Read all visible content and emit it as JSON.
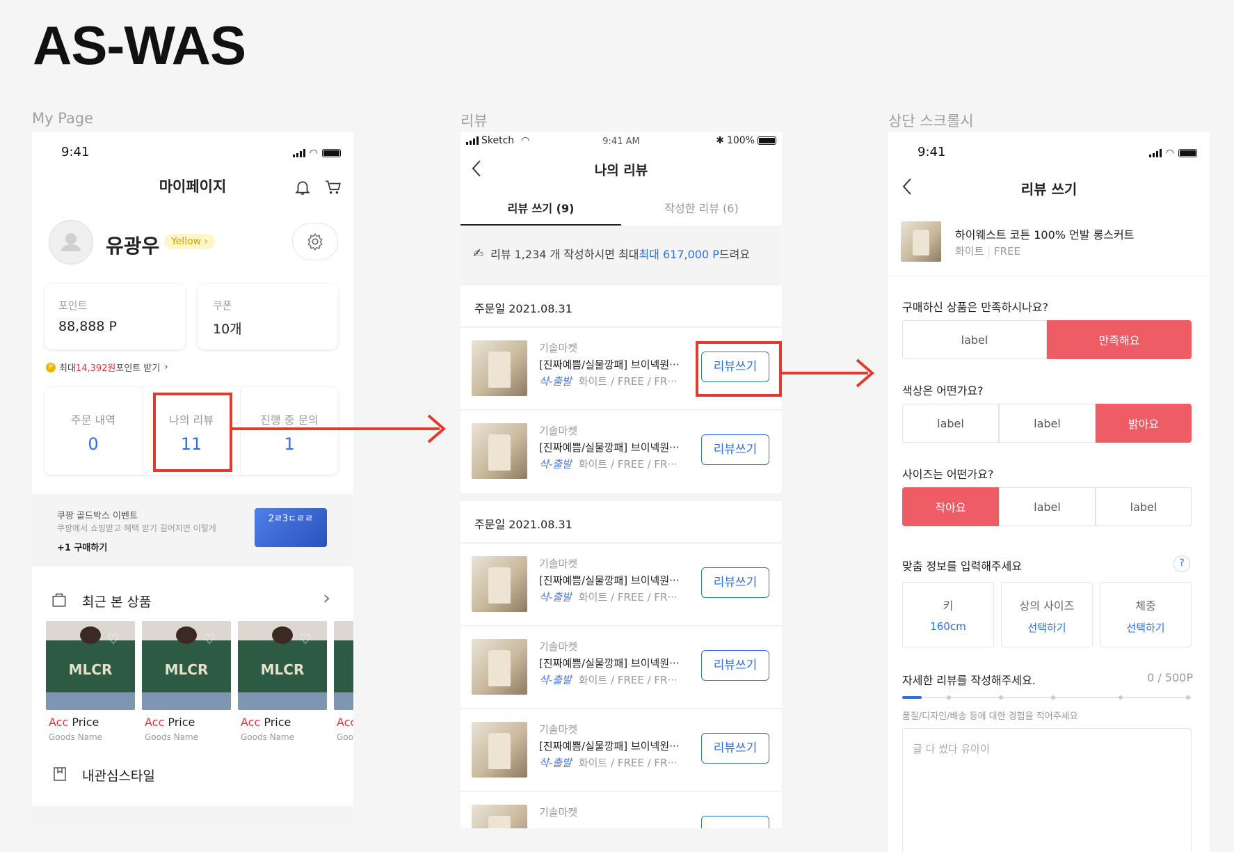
{
  "page_title": "AS-WAS",
  "captions": {
    "s1": "My Page",
    "s2": "리뷰",
    "s3": "상단 스크롤시"
  },
  "s1": {
    "time": "9:41",
    "header": "마이페이지",
    "user": "유광우",
    "grade": "Yellow ›",
    "point_label": "포인트",
    "point_value": "88,888 P",
    "coupon_label": "쿠폰",
    "coupon_value": "10개",
    "promo_prefix": "최대 ",
    "promo_amount": "14,392원",
    "promo_suffix": "포인트 받기",
    "stats": [
      {
        "label": "주문 내역",
        "value": "0"
      },
      {
        "label": "나의 리뷰",
        "value": "11"
      },
      {
        "label": "진행 중 문의",
        "value": "1"
      }
    ],
    "banner": {
      "title": "쿠팡 골드박스 이벤트",
      "desc": "쿠팡에서 쇼핑받고 혜택 받기 길어지면 이렇게",
      "cta": "+1 구매하기",
      "img_text": "2ㄹ3ㄷㄹㄹ"
    },
    "recent_title": "최근 본 상품",
    "products": [
      {
        "brand": "Acc",
        "price": "Price",
        "name": "Goods Name",
        "print": "MLCR"
      },
      {
        "brand": "Acc",
        "price": "Price",
        "name": "Goods Name",
        "print": "MLCR"
      },
      {
        "brand": "Acc",
        "price": "Price",
        "name": "Goods Name",
        "print": "MLCR"
      },
      {
        "brand": "Acc",
        "price": "",
        "name": "Goo",
        "print": ""
      }
    ],
    "style_label": "내관심스타일"
  },
  "s2": {
    "carrier": "Sketch",
    "time": "9:41 AM",
    "battery": "100%",
    "header": "나의 리뷰",
    "tab_active": "리뷰 쓰기 (9)",
    "tab_other": "작성한 리뷰 (6)",
    "notice_pre": "리뷰 1,234 개 작성하시면 최대 ",
    "notice_amount": "최대 617,000 P",
    "notice_post": " 드려요",
    "group1_date": "주문일 2021.08.31",
    "group2_date": "주문일 2021.08.31",
    "item": {
      "shop": "기솔마켓",
      "title": "[진짜예쁨/실물깡패] 브이넥원···",
      "badge": "샥-출발",
      "opt": "화이트 / FREE / FR···",
      "btn": "리뷰쓰기"
    }
  },
  "s3": {
    "time": "9:41",
    "header": "리뷰 쓰기",
    "product_name": "하이웨스트 코튼 100% 언발 롱스커트",
    "product_color": "화이트",
    "product_size": "FREE",
    "q1": "구매하신 상품은 만족하시나요?",
    "q1_opts": [
      "label",
      "만족해요"
    ],
    "q2": "색상은 어떤가요?",
    "q2_opts": [
      "label",
      "label",
      "밝아요"
    ],
    "q3": "사이즈는 어떤가요?",
    "q3_opts": [
      "작아요",
      "label",
      "label"
    ],
    "fit_title": "맞춤 정보를 입력해주세요",
    "help": "?",
    "fit": [
      {
        "label": "키",
        "value": "160cm"
      },
      {
        "label": "상의 사이즈",
        "value": "선택하기"
      },
      {
        "label": "체중",
        "value": "선택하기"
      }
    ],
    "detail_title": "자세한 리뷰를 작성해주세요.",
    "counter": "0 / 500P",
    "detail_hint": "품질/디자인/배송 등에 대한 경험을 적어주세요",
    "textarea_placeholder": "글 다 썼다 유아이"
  },
  "colors": {
    "accent_blue": "#2f6fe4",
    "accent_pink": "#ee5c65",
    "annotation_red": "#e23a2d"
  }
}
